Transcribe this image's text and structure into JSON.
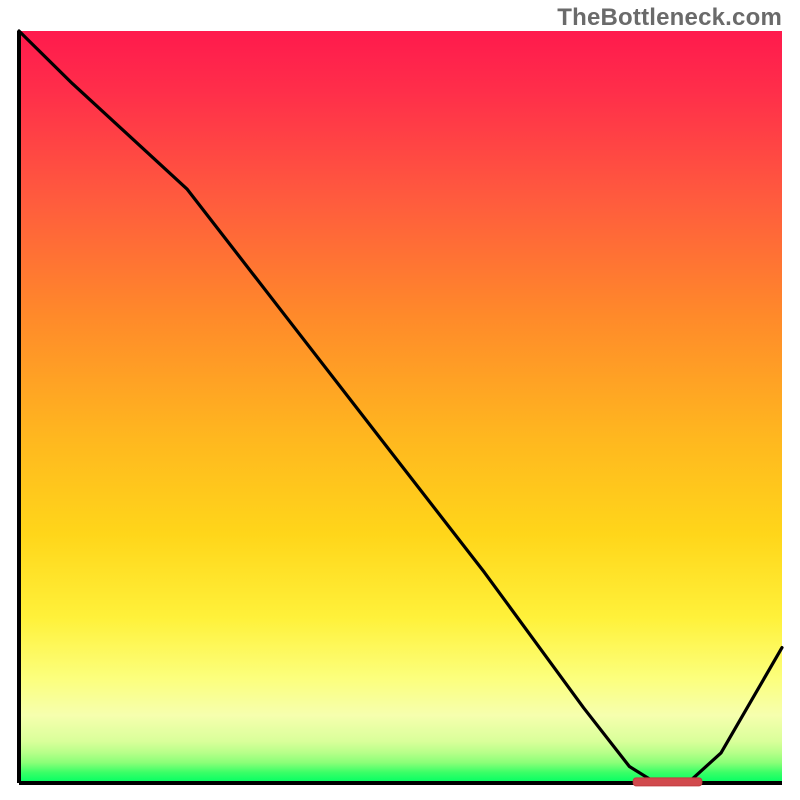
{
  "watermark": "TheBottleneck.com",
  "colors": {
    "axis": "#000000",
    "curve": "#000000",
    "marker": "#d14a4d",
    "gradient_top": "#ff1a4d",
    "gradient_bottom": "#00ff63"
  },
  "chart_data": {
    "type": "line",
    "title": "",
    "xlabel": "",
    "ylabel": "",
    "xlim": [
      0,
      100
    ],
    "ylim": [
      0,
      100
    ],
    "x": [
      0,
      7,
      22,
      35,
      48,
      61,
      74,
      80,
      83,
      88,
      92,
      100
    ],
    "values": [
      100,
      93,
      79,
      62,
      45,
      28,
      10,
      2.2,
      0.3,
      0.3,
      4,
      18
    ],
    "marker": {
      "x_start": 80.5,
      "x_end": 89.5,
      "y": 0.15,
      "label": ""
    },
    "note": "Values are read from the plotted black curve relative to the full plot area; the curve starts at the top-left at y≈100, slopes with a slight knee near x≈22, descends roughly linearly to a flat minimum near x≈83–88 at y≈0.3, then rises to y≈18 at x=100. The small red/coral bar marks the minimum region."
  }
}
